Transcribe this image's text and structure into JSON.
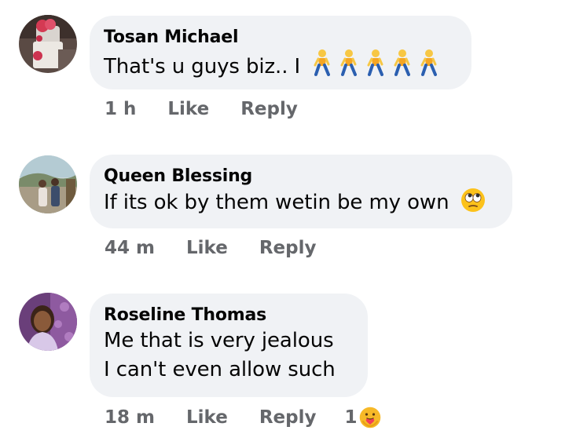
{
  "comments": [
    {
      "author": "Tosan Michael",
      "lines": [
        "That's u guys biz.. I"
      ],
      "emoji": "person-walking-icon",
      "emoji_count": 5,
      "time": "1 h",
      "like_label": "Like",
      "reply_label": "Reply"
    },
    {
      "author": "Queen Blessing",
      "lines": [
        "If its ok by them wetin be my own"
      ],
      "emoji": "face-with-rolling-eyes-icon",
      "time": "44 m",
      "like_label": "Like",
      "reply_label": "Reply"
    },
    {
      "author": "Roseline Thomas",
      "lines": [
        "Me that is very jealous",
        "I  can't even allow such"
      ],
      "time": "18 m",
      "like_label": "Like",
      "reply_label": "Reply",
      "reaction_count": "1",
      "reaction_icon": "care-reaction-icon"
    }
  ],
  "colors": {
    "bubble": "#f0f2f5",
    "meta_text": "#65676b",
    "name_text": "#050505"
  }
}
